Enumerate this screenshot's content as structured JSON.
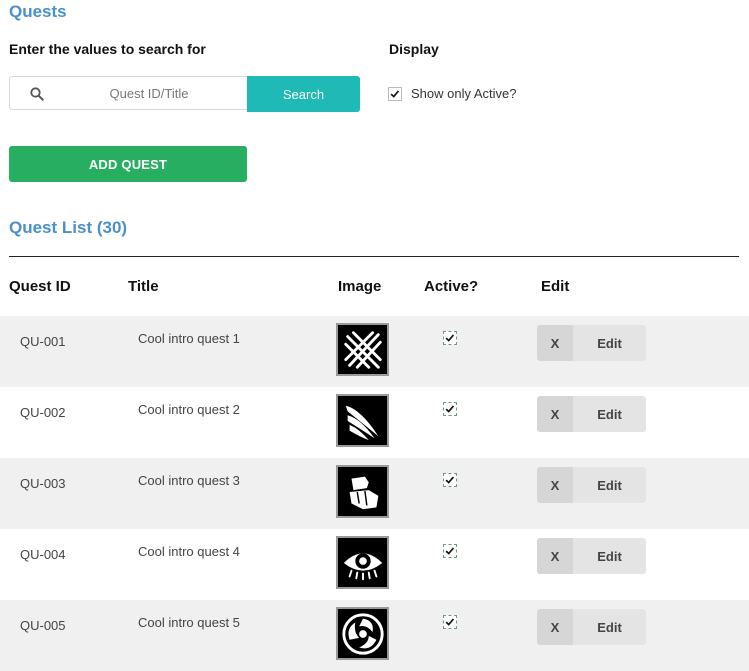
{
  "page": {
    "title": "Quests"
  },
  "search": {
    "label": "Enter the values to search for",
    "placeholder": "Quest ID/Title",
    "value": "",
    "button_label": "Search"
  },
  "display": {
    "label": "Display",
    "active_only_label": "Show only Active?",
    "active_only_checked": true
  },
  "actions": {
    "add_quest_label": "ADD QUEST"
  },
  "list": {
    "heading": "Quest List (30)",
    "columns": [
      "Quest ID",
      "Title",
      "Image",
      "Active?",
      "Edit"
    ],
    "rows": [
      {
        "id": "QU-001",
        "title": "Cool intro quest 1",
        "image_icon": "claw-slash-icon",
        "active": true,
        "delete_label": "X",
        "edit_label": "Edit"
      },
      {
        "id": "QU-002",
        "title": "Cool intro quest 2",
        "image_icon": "feather-slash-icon",
        "active": true,
        "delete_label": "X",
        "edit_label": "Edit"
      },
      {
        "id": "QU-003",
        "title": "Cool intro quest 3",
        "image_icon": "fist-icon",
        "active": true,
        "delete_label": "X",
        "edit_label": "Edit"
      },
      {
        "id": "QU-004",
        "title": "Cool intro quest 4",
        "image_icon": "eye-icon",
        "active": true,
        "delete_label": "X",
        "edit_label": "Edit"
      },
      {
        "id": "QU-005",
        "title": "Cool intro quest 5",
        "image_icon": "triskele-icon",
        "active": true,
        "delete_label": "X",
        "edit_label": "Edit"
      }
    ]
  },
  "colors": {
    "heading": "#4a90cc",
    "search_button": "#1fbab5",
    "add_button": "#27ae60",
    "row_shade": "#f0f0f0"
  }
}
